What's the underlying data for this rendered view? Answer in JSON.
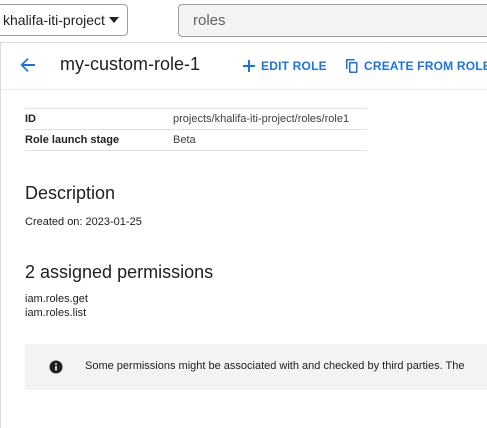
{
  "topbar": {
    "project_name": "khalifa-iti-project",
    "search_value": "roles"
  },
  "header": {
    "title": "my-custom-role-1",
    "edit_label": "EDIT ROLE",
    "create_label": "CREATE FROM ROLE"
  },
  "info": {
    "rows": [
      {
        "key": "ID",
        "value": "projects/khalifa-iti-project/roles/role1"
      },
      {
        "key": "Role launch stage",
        "value": "Beta"
      }
    ]
  },
  "description": {
    "title": "Description",
    "text": "Created on: 2023-01-25"
  },
  "permissions": {
    "title": "2 assigned permissions",
    "items": [
      "iam.roles.get",
      "iam.roles.list"
    ]
  },
  "banner": {
    "text": "Some permissions might be associated with and checked by third parties. The"
  },
  "colors": {
    "accent": "#1a73e8",
    "banner_bg": "#f1f3f4"
  }
}
